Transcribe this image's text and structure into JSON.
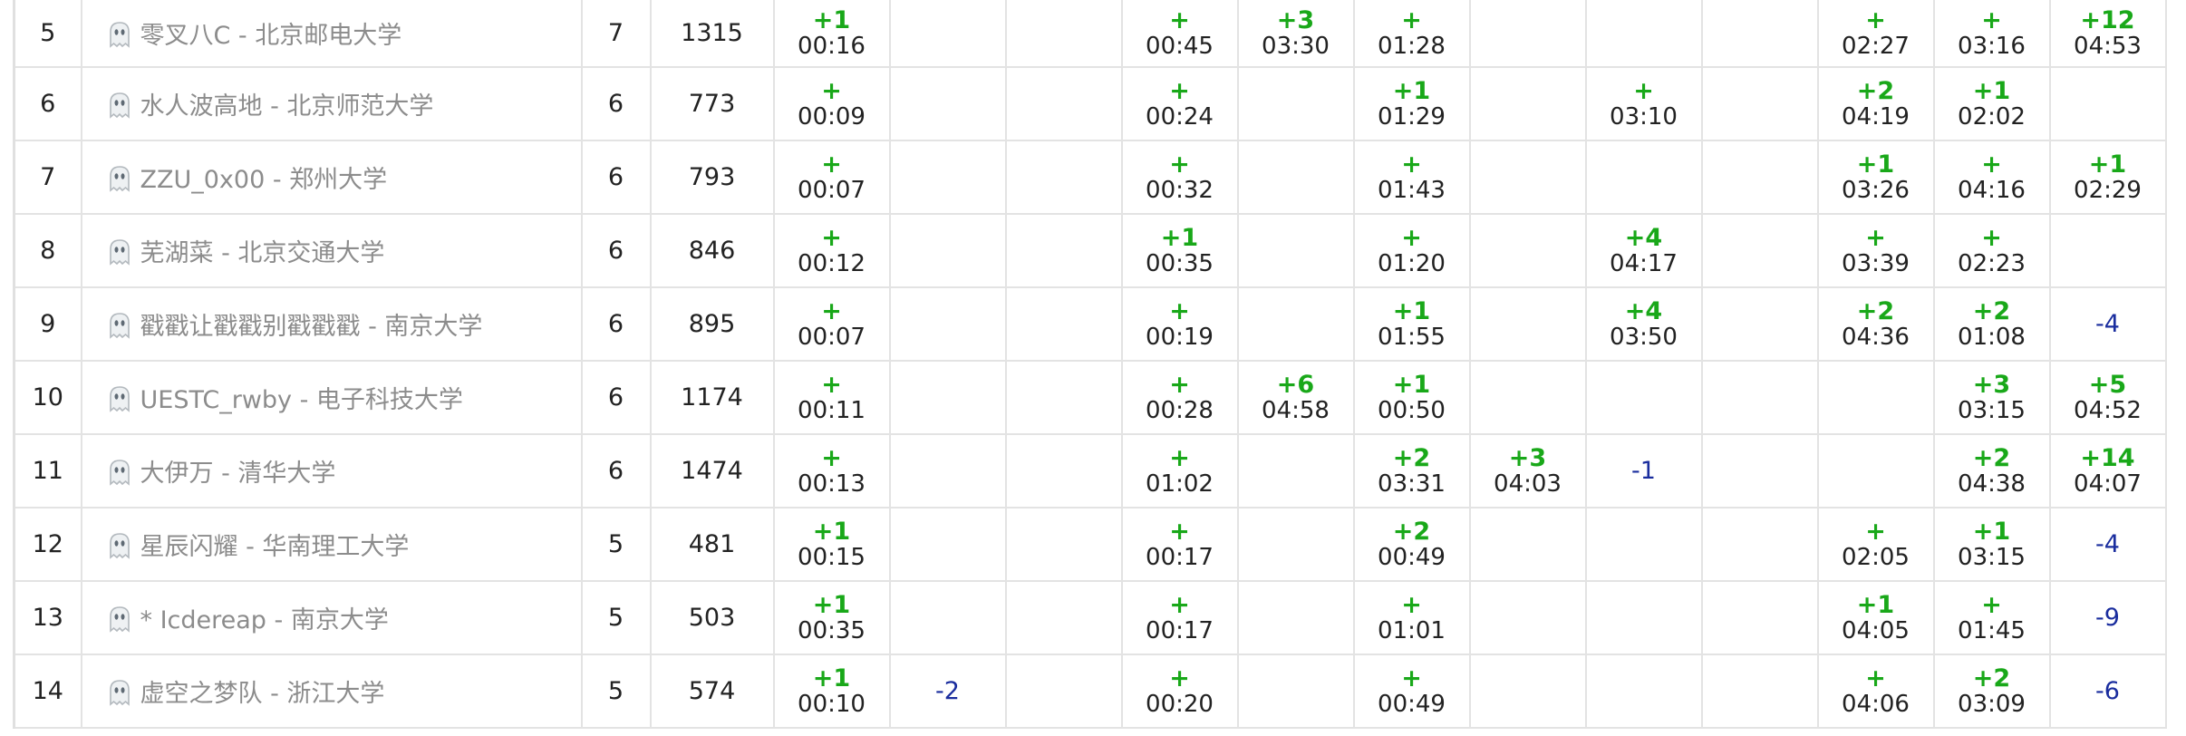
{
  "standings": {
    "rows": [
      {
        "rank": "5",
        "team": "零叉八C - 北京邮电大学",
        "solved": "7",
        "penalty": "1315",
        "problems": [
          [
            "+1",
            "00:16"
          ],
          null,
          null,
          [
            "+",
            "00:45"
          ],
          [
            "+3",
            "03:30"
          ],
          [
            "+",
            "01:28"
          ],
          null,
          null,
          null,
          [
            "+",
            "02:27"
          ],
          [
            "+",
            "03:16"
          ],
          [
            "+12",
            "04:53"
          ]
        ]
      },
      {
        "rank": "6",
        "team": "水人波高地 - 北京师范大学",
        "solved": "6",
        "penalty": "773",
        "problems": [
          [
            "+",
            "00:09"
          ],
          null,
          null,
          [
            "+",
            "00:24"
          ],
          null,
          [
            "+1",
            "01:29"
          ],
          null,
          [
            "+",
            "03:10"
          ],
          null,
          [
            "+2",
            "04:19"
          ],
          [
            "+1",
            "02:02"
          ],
          null
        ]
      },
      {
        "rank": "7",
        "team": "ZZU_0x00 - 郑州大学",
        "solved": "6",
        "penalty": "793",
        "problems": [
          [
            "+",
            "00:07"
          ],
          null,
          null,
          [
            "+",
            "00:32"
          ],
          null,
          [
            "+",
            "01:43"
          ],
          null,
          null,
          null,
          [
            "+1",
            "03:26"
          ],
          [
            "+",
            "04:16"
          ],
          [
            "+1",
            "02:29"
          ]
        ]
      },
      {
        "rank": "8",
        "team": "芜湖菜 - 北京交通大学",
        "solved": "6",
        "penalty": "846",
        "problems": [
          [
            "+",
            "00:12"
          ],
          null,
          null,
          [
            "+1",
            "00:35"
          ],
          null,
          [
            "+",
            "01:20"
          ],
          null,
          [
            "+4",
            "04:17"
          ],
          null,
          [
            "+",
            "03:39"
          ],
          [
            "+",
            "02:23"
          ],
          null
        ]
      },
      {
        "rank": "9",
        "team": "戳戳让戳戳别戳戳戳 - 南京大学",
        "solved": "6",
        "penalty": "895",
        "problems": [
          [
            "+",
            "00:07"
          ],
          null,
          null,
          [
            "+",
            "00:19"
          ],
          null,
          [
            "+1",
            "01:55"
          ],
          null,
          [
            "+4",
            "03:50"
          ],
          null,
          [
            "+2",
            "04:36"
          ],
          [
            "+2",
            "01:08"
          ],
          "-4"
        ]
      },
      {
        "rank": "10",
        "team": "UESTC_rwby - 电子科技大学",
        "solved": "6",
        "penalty": "1174",
        "problems": [
          [
            "+",
            "00:11"
          ],
          null,
          null,
          [
            "+",
            "00:28"
          ],
          [
            "+6",
            "04:58"
          ],
          [
            "+1",
            "00:50"
          ],
          null,
          null,
          null,
          null,
          [
            "+3",
            "03:15"
          ],
          [
            "+5",
            "04:52"
          ]
        ]
      },
      {
        "rank": "11",
        "team": "大伊万 - 清华大学",
        "solved": "6",
        "penalty": "1474",
        "problems": [
          [
            "+",
            "00:13"
          ],
          null,
          null,
          [
            "+",
            "01:02"
          ],
          null,
          [
            "+2",
            "03:31"
          ],
          [
            "+3",
            "04:03"
          ],
          "-1",
          null,
          null,
          [
            "+2",
            "04:38"
          ],
          [
            "+14",
            "04:07"
          ]
        ]
      },
      {
        "rank": "12",
        "team": "星辰闪耀 - 华南理工大学",
        "solved": "5",
        "penalty": "481",
        "problems": [
          [
            "+1",
            "00:15"
          ],
          null,
          null,
          [
            "+",
            "00:17"
          ],
          null,
          [
            "+2",
            "00:49"
          ],
          null,
          null,
          null,
          [
            "+",
            "02:05"
          ],
          [
            "+1",
            "03:15"
          ],
          "-4"
        ]
      },
      {
        "rank": "13",
        "team": "* Icdereap - 南京大学",
        "solved": "5",
        "penalty": "503",
        "problems": [
          [
            "+1",
            "00:35"
          ],
          null,
          null,
          [
            "+",
            "00:17"
          ],
          null,
          [
            "+",
            "01:01"
          ],
          null,
          null,
          null,
          [
            "+1",
            "04:05"
          ],
          [
            "+",
            "01:45"
          ],
          "-9"
        ]
      },
      {
        "rank": "14",
        "team": "虚空之梦队 - 浙江大学",
        "solved": "5",
        "penalty": "574",
        "problems": [
          [
            "+1",
            "00:10"
          ],
          "-2",
          null,
          [
            "+",
            "00:20"
          ],
          null,
          [
            "+",
            "00:49"
          ],
          null,
          null,
          null,
          [
            "+",
            "04:06"
          ],
          [
            "+2",
            "03:09"
          ],
          "-6"
        ]
      }
    ]
  },
  "icons": {
    "team": "ghost-avatar-icon"
  },
  "colors": {
    "accepted": "#19a819",
    "rejected": "#1a2d9e",
    "team_name": "#8c8c8c",
    "grid": "#e3e3e3"
  }
}
